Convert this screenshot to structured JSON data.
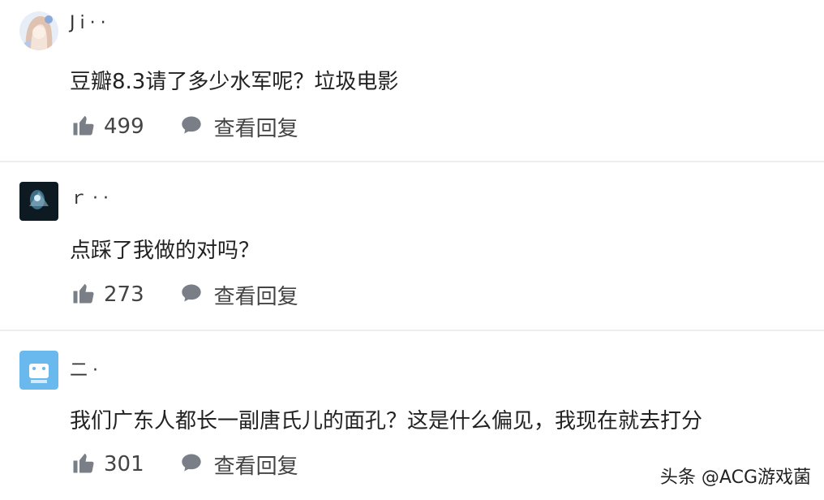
{
  "comments": [
    {
      "username": "Ji··",
      "text": "豆瓣8.3请了多少水军呢？垃圾电影",
      "likes": "499",
      "reply_label": "查看回复"
    },
    {
      "username": "ｒ··",
      "text": "点踩了我做的对吗？",
      "likes": "273",
      "reply_label": "查看回复"
    },
    {
      "username": "二·",
      "text": "我们广东人都长一副唐氏儿的面孔？这是什么偏见，我现在就去打分",
      "likes": "301",
      "reply_label": "查看回复"
    }
  ],
  "watermark": "头条 @ACG游戏菌",
  "icons": {
    "like": "thumbs-up-icon",
    "reply": "speech-bubble-icon"
  },
  "colors": {
    "icon": "#7a7f87",
    "separator": "#eeeeee"
  }
}
